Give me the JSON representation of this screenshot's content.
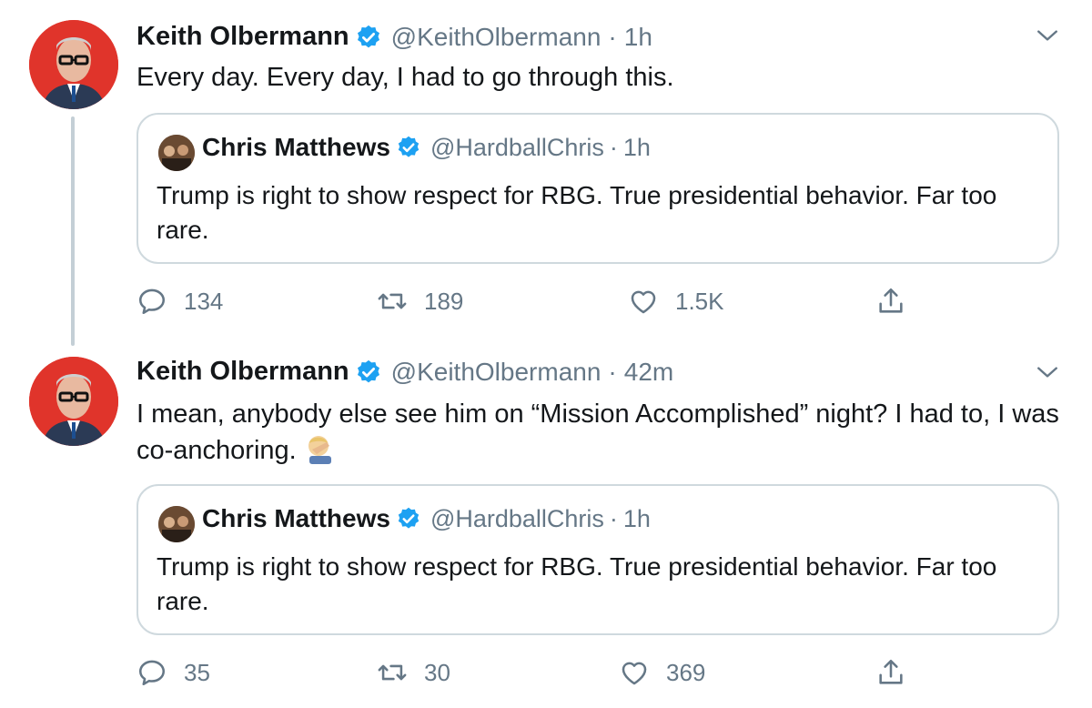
{
  "colors": {
    "accent": "#1da1f2",
    "secondary_text": "#657786",
    "border": "#cfd9de",
    "avatar_bg": "#e0342b"
  },
  "tweets": [
    {
      "author_name": "Keith Olbermann",
      "handle": "@KeithOlbermann",
      "separator": "·",
      "time": "1h",
      "text": "Every day. Every day, I had to go through this.",
      "quoted": {
        "author_name": "Chris Matthews",
        "handle": "@HardballChris",
        "separator": "·",
        "time": "1h",
        "text": "Trump is right to show respect for RBG. True presidential behavior. Far too rare."
      },
      "replies": "134",
      "retweets": "189",
      "likes": "1.5K"
    },
    {
      "author_name": "Keith Olbermann",
      "handle": "@KeithOlbermann",
      "separator": "·",
      "time": "42m",
      "text": "I mean, anybody else see him on “Mission Accomplished” night? I had to, I was co-anchoring.",
      "emoji": "face-palm-emoji",
      "quoted": {
        "author_name": "Chris Matthews",
        "handle": "@HardballChris",
        "separator": "·",
        "time": "1h",
        "text": "Trump is right to show respect for RBG. True presidential behavior. Far too rare."
      },
      "replies": "35",
      "retweets": "30",
      "likes": "369"
    }
  ],
  "icons": {
    "verified": "verified-badge-icon",
    "chevron": "chevron-down-icon",
    "reply": "reply-icon",
    "retweet": "retweet-icon",
    "like": "heart-icon",
    "share": "share-icon"
  }
}
